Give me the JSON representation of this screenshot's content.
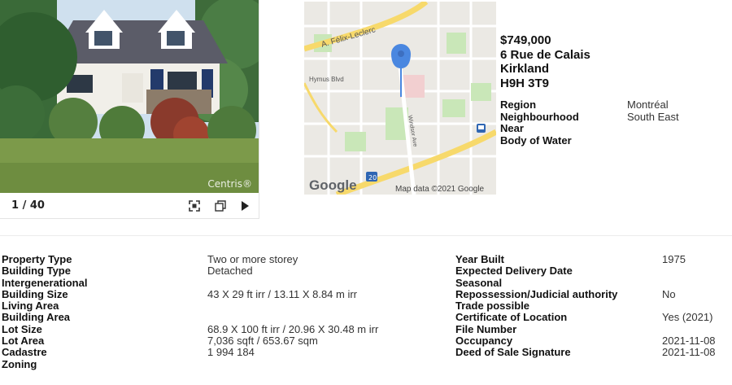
{
  "gallery": {
    "counter": "1 / 40",
    "watermark": "Centris®",
    "icons": {
      "fullscreen": "fullscreen-icon",
      "gallery": "gallery-icon",
      "next": "play-next-icon"
    }
  },
  "map": {
    "labels": {
      "road_top": "A. Félix-Leclerc",
      "street": "Hymus Blvd",
      "avenue": "Windsor Ave",
      "highway": "20",
      "logo": "Google",
      "attribution": "Map data ©2021 Google"
    }
  },
  "listing": {
    "price": "$749,000",
    "address_line": "6 Rue de Calais",
    "city": "Kirkland",
    "postal_code": "H9H 3T9",
    "location": [
      {
        "label": "Region",
        "value": "Montréal"
      },
      {
        "label": "Neighbourhood",
        "value": "South East"
      },
      {
        "label": "Near",
        "value": ""
      },
      {
        "label": "Body of Water",
        "value": ""
      }
    ]
  },
  "details": {
    "left": [
      {
        "label": "Property Type",
        "value": "Two or more storey"
      },
      {
        "label": "Building Type",
        "value": "Detached"
      },
      {
        "label": "Intergenerational",
        "value": ""
      },
      {
        "label": "Building Size",
        "value": "43 X 29 ft irr / 13.11 X 8.84 m irr"
      },
      {
        "label": "Living Area",
        "value": ""
      },
      {
        "label": "Building Area",
        "value": ""
      },
      {
        "label": "Lot Size",
        "value": "68.9 X 100 ft irr / 20.96 X 30.48 m irr"
      },
      {
        "label": "Lot Area",
        "value": "7,036 sqft / 653.67 sqm"
      },
      {
        "label": "Cadastre",
        "value": "1 994 184"
      },
      {
        "label": "Zoning",
        "value": ""
      }
    ],
    "right": [
      {
        "label": "Year Built",
        "value": "1975"
      },
      {
        "label": "Expected Delivery Date",
        "value": ""
      },
      {
        "label": "Seasonal",
        "value": ""
      },
      {
        "label": "Repossession/Judicial authority",
        "value": "No"
      },
      {
        "label": "Trade possible",
        "value": ""
      },
      {
        "label": "Certificate of Location",
        "value": "Yes (2021)"
      },
      {
        "label": "File Number",
        "value": ""
      },
      {
        "label": "Occupancy",
        "value": "2021-11-08"
      },
      {
        "label": "Deed of Sale Signature",
        "value": "2021-11-08"
      }
    ]
  },
  "colors": {
    "map_pin": "#4a87e0",
    "map_highway": "#f7d96b",
    "map_park": "#c9e7b8",
    "text_dark": "#111111"
  }
}
